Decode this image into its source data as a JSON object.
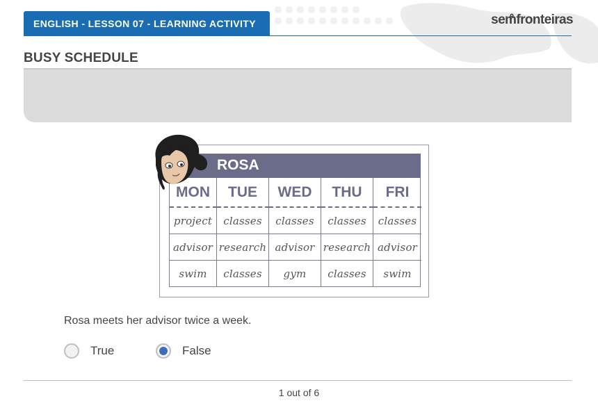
{
  "header": {
    "lesson_tab": "ENGLISH - LESSON 07 - LEARNING ACTIVITY",
    "brand": "semfronteiras",
    "accent_color": "#1a6db3"
  },
  "activity": {
    "title": "BUSY SCHEDULE"
  },
  "schedule": {
    "name": "ROSA",
    "days": [
      "MON",
      "TUE",
      "WED",
      "THU",
      "FRI"
    ],
    "rows": [
      [
        "project",
        "classes",
        "classes",
        "classes",
        "classes"
      ],
      [
        "advisor",
        "research",
        "advisor",
        "research",
        "advisor"
      ],
      [
        "swim",
        "classes",
        "gym",
        "classes",
        "swim"
      ]
    ]
  },
  "question": {
    "text": "Rosa meets her advisor twice a week.",
    "options": [
      "True",
      "False"
    ],
    "selected": "False"
  },
  "pagination": {
    "label": "1 out of 6"
  },
  "icons": {
    "brand_pin": "location-pin-icon",
    "avatar": "character-avatar-icon"
  }
}
